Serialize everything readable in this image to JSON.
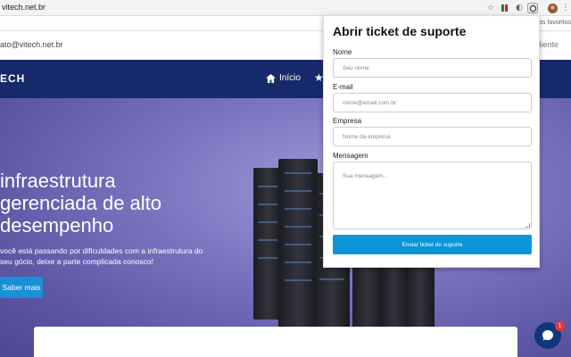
{
  "browser": {
    "url": "vitech.net.br",
    "bookmarks_text": "Outros favoritos"
  },
  "site": {
    "contact_email": "ato@vitech.net.br",
    "client_area": "Cliente",
    "logo": "ECH",
    "nav_home": "Início",
    "hero_title": "infraestrutura gerenciada de alto desempenho",
    "hero_subtitle": "você está passando por dificuldades com a infraestrutura do seu gócio, deixe a parte complicada conosco!",
    "hero_button": "Saber mais",
    "chat_badge_count": "1"
  },
  "popup": {
    "title": "Abrir ticket de suporte",
    "fields": [
      {
        "label": "Nome",
        "placeholder": "Seu nome"
      },
      {
        "label": "E-mail",
        "placeholder": "nome@email.com.br"
      },
      {
        "label": "Empresa",
        "placeholder": "Nome da empresa"
      },
      {
        "label": "Mensagem",
        "placeholder": "Sua mensagem..."
      }
    ],
    "submit_label": "Enviar ticket de suporte"
  },
  "colors": {
    "navbar": "#162a6b",
    "accent": "#0a95d9",
    "chat": "#12367a",
    "badge": "#e53935"
  }
}
